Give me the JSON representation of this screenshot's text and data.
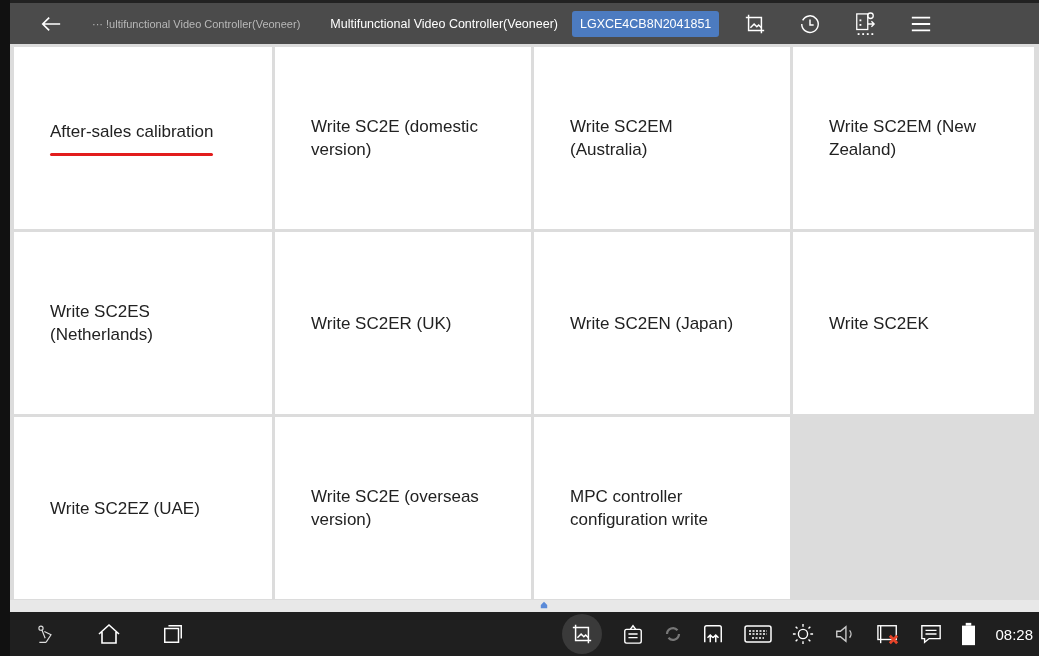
{
  "top_bar": {
    "breadcrumb": "··· !ultifunctional Video Controller(Veoneer)",
    "title": "Multifunctional Video Controller(Veoneer)",
    "vin": "LGXCE4CB8N2041851"
  },
  "functions": [
    {
      "label": "After-sales calibration",
      "selected": true
    },
    {
      "label": "Write SC2E (domestic version)",
      "selected": false
    },
    {
      "label": "Write SC2EM (Australia)",
      "selected": false
    },
    {
      "label": "Write SC2EM (New Zealand)",
      "selected": false
    },
    {
      "label": "Write SC2ES (Netherlands)",
      "selected": false
    },
    {
      "label": "Write SC2ER (UK)",
      "selected": false
    },
    {
      "label": "Write SC2EN (Japan)",
      "selected": false
    },
    {
      "label": "Write SC2EK",
      "selected": false
    },
    {
      "label": "Write SC2EZ (UAE)",
      "selected": false
    },
    {
      "label": "Write SC2E (overseas version)",
      "selected": false
    },
    {
      "label": "MPC controller configuration write",
      "selected": false
    }
  ],
  "status_bar": {
    "time": "08:28"
  }
}
